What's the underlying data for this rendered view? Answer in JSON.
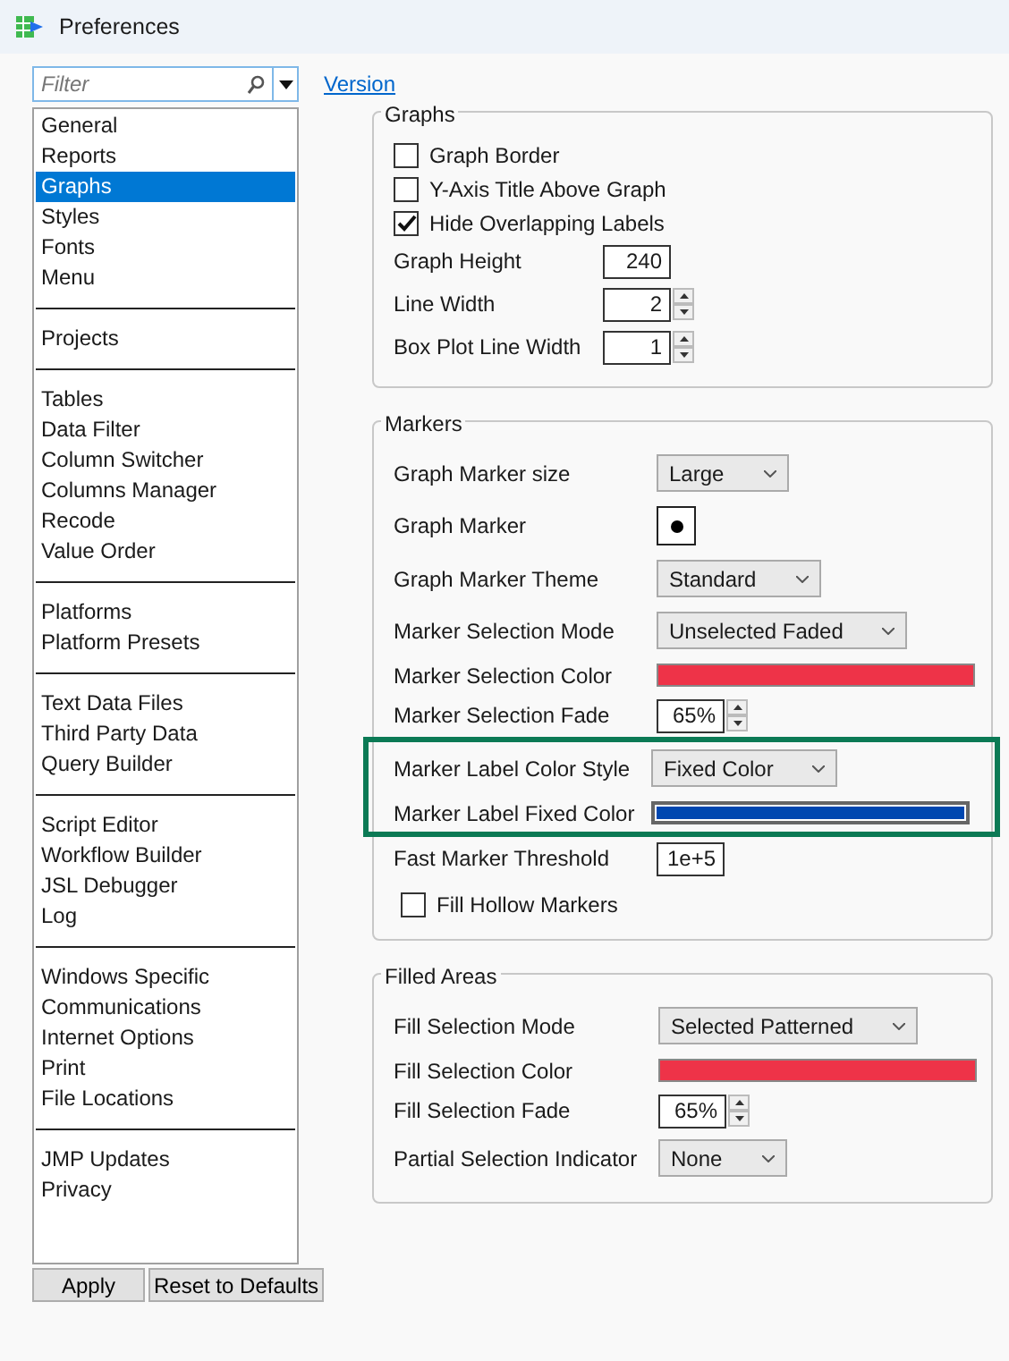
{
  "window": {
    "title": "Preferences"
  },
  "filter": {
    "placeholder": "Filter"
  },
  "version_link": "Version",
  "category_groups": [
    {
      "items": [
        {
          "label": "General",
          "selected": false
        },
        {
          "label": "Reports",
          "selected": false
        },
        {
          "label": "Graphs",
          "selected": true
        },
        {
          "label": "Styles",
          "selected": false
        },
        {
          "label": "Fonts",
          "selected": false
        },
        {
          "label": "Menu",
          "selected": false
        }
      ]
    },
    {
      "items": [
        {
          "label": "Projects",
          "selected": false
        }
      ]
    },
    {
      "items": [
        {
          "label": "Tables",
          "selected": false
        },
        {
          "label": "Data Filter",
          "selected": false
        },
        {
          "label": "Column Switcher",
          "selected": false
        },
        {
          "label": "Columns Manager",
          "selected": false
        },
        {
          "label": "Recode",
          "selected": false
        },
        {
          "label": "Value Order",
          "selected": false
        }
      ]
    },
    {
      "items": [
        {
          "label": "Platforms",
          "selected": false
        },
        {
          "label": "Platform Presets",
          "selected": false
        }
      ]
    },
    {
      "items": [
        {
          "label": "Text Data Files",
          "selected": false
        },
        {
          "label": "Third Party Data",
          "selected": false
        },
        {
          "label": "Query Builder",
          "selected": false
        }
      ]
    },
    {
      "items": [
        {
          "label": "Script Editor",
          "selected": false
        },
        {
          "label": "Workflow Builder",
          "selected": false
        },
        {
          "label": "JSL Debugger",
          "selected": false
        },
        {
          "label": "Log",
          "selected": false
        }
      ]
    },
    {
      "items": [
        {
          "label": "Windows Specific",
          "selected": false
        },
        {
          "label": "Communications",
          "selected": false
        },
        {
          "label": "Internet Options",
          "selected": false
        },
        {
          "label": "Print",
          "selected": false
        },
        {
          "label": "File Locations",
          "selected": false
        }
      ]
    },
    {
      "items": [
        {
          "label": "JMP Updates",
          "selected": false
        },
        {
          "label": "Privacy",
          "selected": false
        }
      ]
    }
  ],
  "buttons": [
    "Apply",
    "Reset to Defaults"
  ],
  "sections": [
    {
      "title": "Graphs",
      "rows": [
        {
          "kind": "checkbox",
          "label": "Graph Border",
          "checked": false
        },
        {
          "kind": "checkbox",
          "label": "Y-Axis Title Above Graph",
          "checked": false
        },
        {
          "kind": "checkbox",
          "label": "Hide Overlapping Labels",
          "checked": true
        },
        {
          "kind": "number",
          "label": "Graph Height",
          "value": "240"
        },
        {
          "kind": "spinner",
          "label": "Line Width",
          "value": "2"
        },
        {
          "kind": "spinner",
          "label": "Box Plot Line Width",
          "value": "1"
        }
      ]
    },
    {
      "title": "Markers",
      "rows": [
        {
          "kind": "dropdown",
          "label": "Graph Marker size",
          "value": "Large"
        },
        {
          "kind": "marker",
          "label": "Graph Marker"
        },
        {
          "kind": "dropdown",
          "label": "Graph Marker Theme",
          "value": "Standard"
        },
        {
          "kind": "dropdown",
          "label": "Marker Selection Mode",
          "value": "Unselected Faded"
        },
        {
          "kind": "color",
          "label": "Marker Selection Color",
          "color": "#ee3348"
        },
        {
          "kind": "spinner",
          "label": "Marker Selection Fade",
          "value": "65%"
        },
        {
          "kind": "dropdown",
          "label": "Marker Label Color Style",
          "value": "Fixed Color",
          "highlighted": true
        },
        {
          "kind": "color",
          "label": "Marker Label Fixed Color",
          "color": "#0047b0",
          "highlighted": true
        },
        {
          "kind": "number",
          "label": "Fast Marker Threshold",
          "value": "1e+5"
        },
        {
          "kind": "checkbox",
          "label": "Fill Hollow Markers",
          "checked": false
        }
      ]
    },
    {
      "title": "Filled Areas",
      "rows": [
        {
          "kind": "dropdown",
          "label": "Fill Selection Mode",
          "value": "Selected Patterned"
        },
        {
          "kind": "color",
          "label": "Fill Selection Color",
          "color": "#ee3348"
        },
        {
          "kind": "spinner",
          "label": "Fill Selection Fade",
          "value": "65%"
        },
        {
          "kind": "dropdown",
          "label": "Partial Selection Indicator",
          "value": "None"
        }
      ]
    }
  ]
}
